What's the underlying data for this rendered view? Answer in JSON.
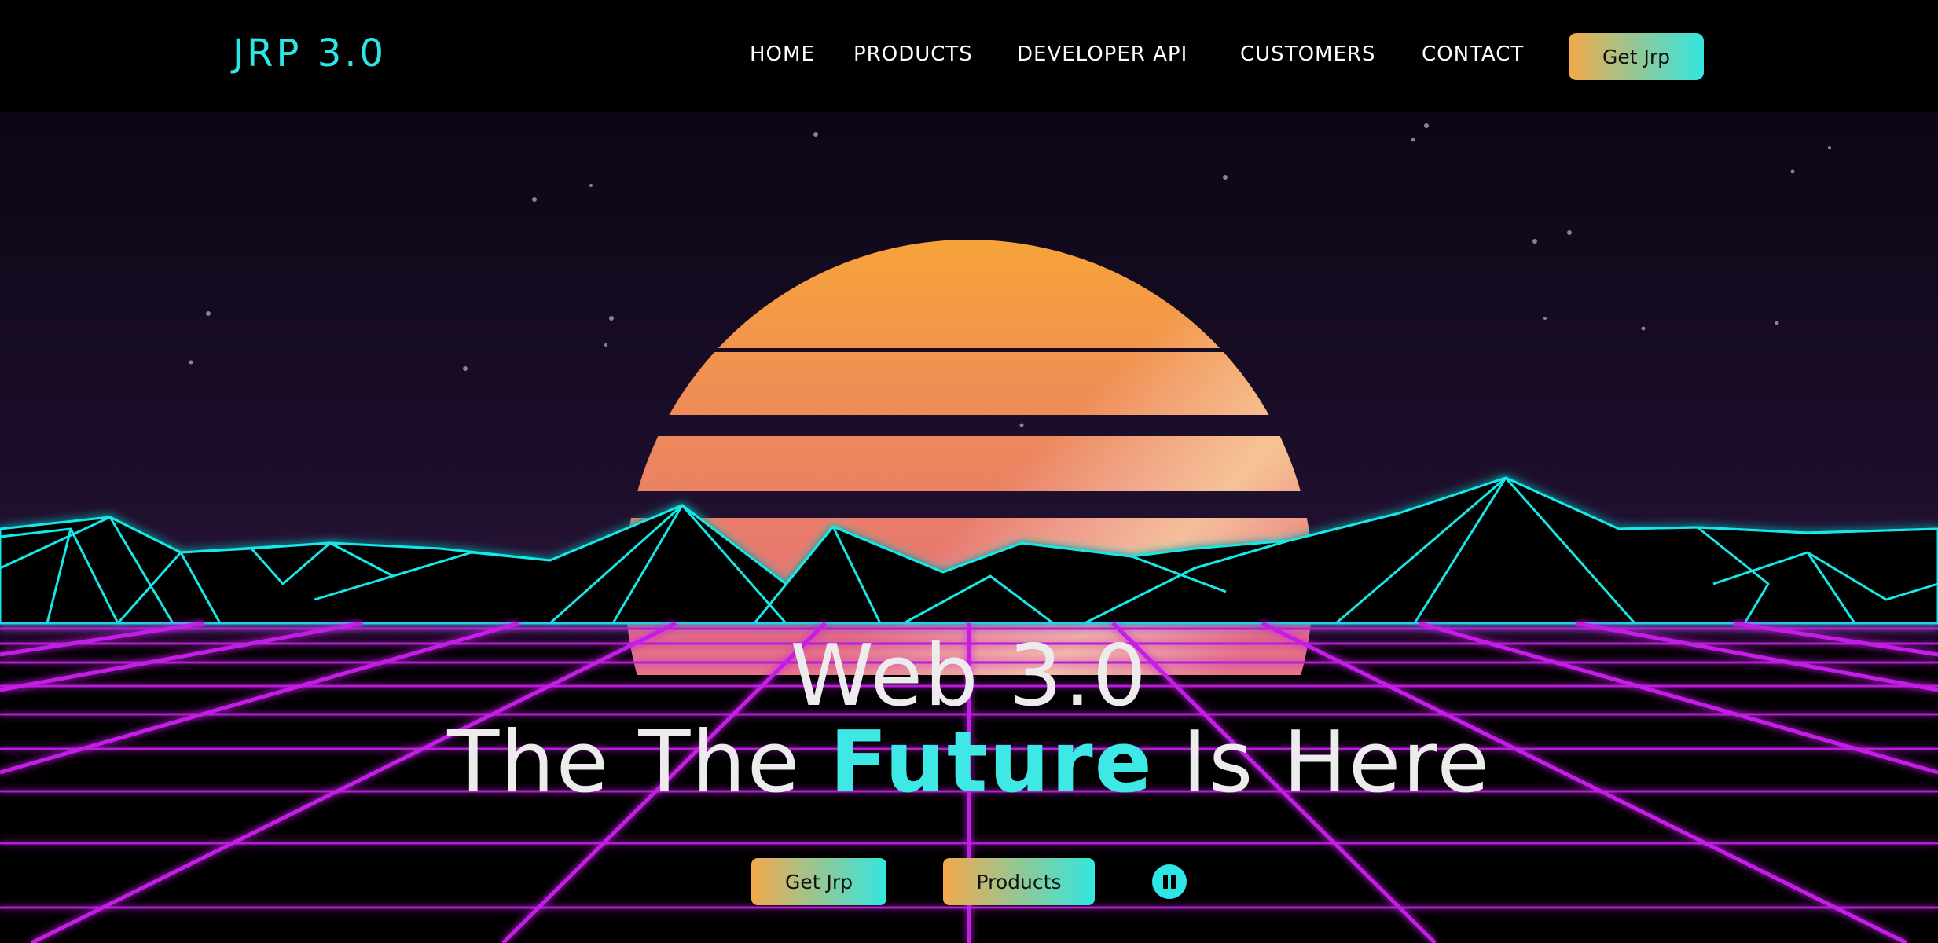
{
  "nav": {
    "logo": "JRP 3.0",
    "links": [
      "HOME",
      "PRODUCTS",
      "DEVELOPER API",
      "CUSTOMERS",
      "CONTACT"
    ],
    "cta": "Get Jrp"
  },
  "hero": {
    "title_line1": "Web 3.0",
    "title_line2_before": "The The ",
    "title_line2_accent": "Future",
    "title_line2_after": " Is Here",
    "primary_button": "Get Jrp",
    "secondary_button": "Products",
    "pause_icon": "pause-icon"
  },
  "colors": {
    "accent_cyan": "#2ee6e6",
    "grid_magenta": "#c51ee8",
    "sun_top": "#f7a33a",
    "sun_bottom": "#f36fc0",
    "button_gradient_start": "#f3a94b",
    "button_gradient_end": "#33e6e0"
  }
}
